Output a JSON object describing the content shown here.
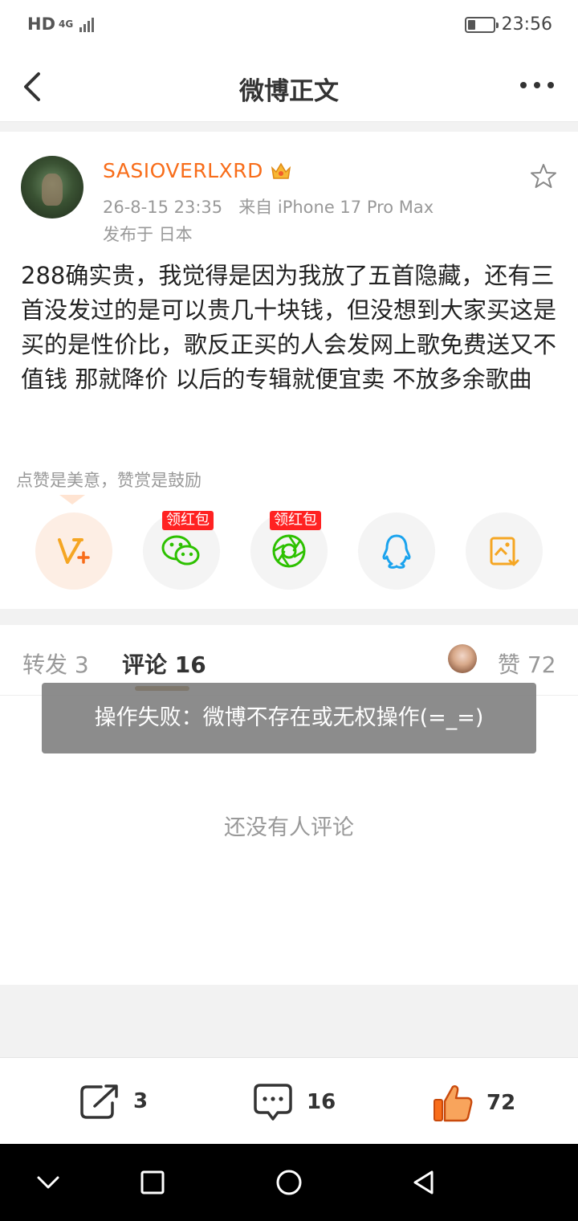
{
  "status_bar": {
    "network": "HD",
    "network_gen": "4G",
    "time": "23:56",
    "battery_level": 0.3
  },
  "nav": {
    "title": "微博正文"
  },
  "post": {
    "username": "SASIOVERLXRD",
    "timestamp": "26-8-15 23:35",
    "source": "来自 iPhone 17 Pro Max",
    "location": "发布于 日本",
    "text": "288确实贵，我觉得是因为我放了五首隐藏，还有三首没发过的是可以贵几十块钱，但没想到大家买这是买的是性价比，歌反正买的人会发网上歌免费送又不值钱 那就降价  以后的专辑就便宜卖 不放多余歌曲",
    "reward_hint": "点赞是美意，赞赏是鼓励",
    "share_badge": "领红包"
  },
  "tabs": {
    "repost": "转发 3",
    "comment": "评论 16",
    "like": "赞 72"
  },
  "comments": {
    "empty": "还没有人评论"
  },
  "toast": {
    "message": "操作失败：微博不存在或无权操作(=_=)"
  },
  "bottom": {
    "repost_count": "3",
    "comment_count": "16",
    "like_count": "72"
  },
  "icons": {
    "back": "chevron-left-icon",
    "more": "more-dots-icon",
    "star": "star-icon",
    "reward": "reward-v-plus-icon",
    "wechat": "wechat-icon",
    "moments": "moments-icon",
    "qq": "qq-icon",
    "save_image": "save-image-icon"
  },
  "colors": {
    "accent": "#f86d1a",
    "wechat": "#2dc100",
    "qq": "#1aa3ee",
    "save": "#f5a623",
    "badge": "#ff2222"
  }
}
